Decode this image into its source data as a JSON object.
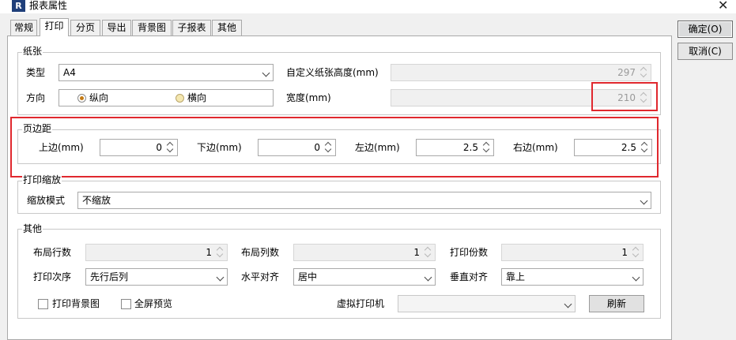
{
  "window": {
    "title": "报表属性",
    "app_icon_letter": "R"
  },
  "tabs": [
    "常规",
    "打印",
    "分页",
    "导出",
    "背景图",
    "子报表",
    "其他"
  ],
  "active_tab": "打印",
  "side_buttons": {
    "ok": "确定(O)",
    "cancel": "取消(C)"
  },
  "paper": {
    "legend": "纸张",
    "type_label": "类型",
    "type_value": "A4",
    "direction_label": "方向",
    "portrait_label": "纵向",
    "landscape_label": "横向",
    "selected_direction": "portrait",
    "custom_height_label": "自定义纸张高度(mm)",
    "custom_height_value": "297",
    "width_label": "宽度(mm)",
    "width_value": "210"
  },
  "margins": {
    "legend": "页边距",
    "top_label": "上边(mm)",
    "top_value": "0",
    "bottom_label": "下边(mm)",
    "bottom_value": "0",
    "left_label": "左边(mm)",
    "left_value": "2.5",
    "right_label": "右边(mm)",
    "right_value": "2.5"
  },
  "scale": {
    "legend": "打印缩放",
    "mode_label": "缩放模式",
    "mode_value": "不缩放"
  },
  "other": {
    "legend": "其他",
    "layout_rows_label": "布局行数",
    "layout_rows_value": "1",
    "layout_cols_label": "布局列数",
    "layout_cols_value": "1",
    "copies_label": "打印份数",
    "copies_value": "1",
    "print_order_label": "打印次序",
    "print_order_value": "先行后列",
    "h_align_label": "水平对齐",
    "h_align_value": "居中",
    "v_align_label": "垂直对齐",
    "v_align_value": "靠上",
    "print_bg_label": "打印背景图",
    "fullscreen_preview_label": "全屏预览",
    "virtual_printer_label": "虚拟打印机",
    "virtual_printer_value": "",
    "refresh_label": "刷新"
  },
  "colors": {
    "highlight": "#e0282e",
    "window_bg": "#f0f0f0",
    "panel_bg": "#ffffff"
  }
}
